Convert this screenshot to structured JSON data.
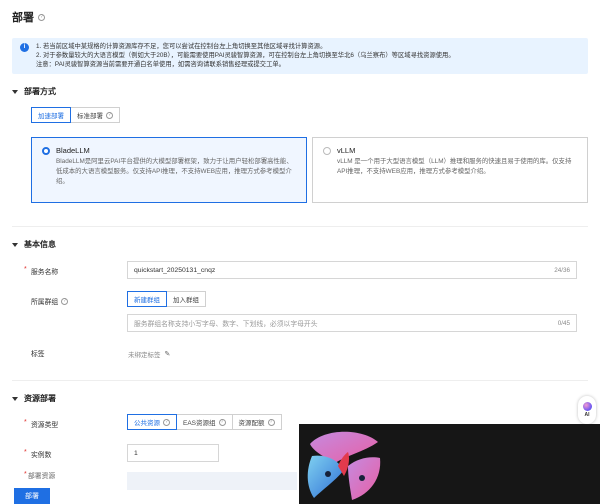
{
  "page": {
    "title": "部署"
  },
  "notice": {
    "line1": "1. 若当前区域中某规格的计算资源库存不足，您可以尝试在控制台左上角切换至其他区域寻找计算资源。",
    "line2": "2. 对于参数量较大的大语言模型（例如大于20B），可能需要使用PAI灵骏智算资源，可在控制台左上角切换至华北6（乌兰察布）等区域寻找资源使用。",
    "line3": "注意：PAI灵骏智算资源当前需要开通白名单使用，如需咨询请联系销售经理或提交工单。"
  },
  "deploy_method": {
    "section_title": "部署方式",
    "tabs": [
      "加速部署",
      "标准部署"
    ],
    "cards": [
      {
        "name": "BladeLLM",
        "desc": "BladeLLM是阿里云PAI平台提供的大模型部署框架，致力于让用户轻松部署高性能、低成本的大语言模型服务。仅支持API推理，不支持WEB应用，推理方式参考模型介绍。"
      },
      {
        "name": "vLLM",
        "desc": "vLLM 是一个用于大型语言模型（LLM）推理和服务的快速且易于使用的库。仅支持API推理，不支持WEB应用，推理方式参考模型介绍。"
      }
    ]
  },
  "basic_info": {
    "section_title": "基本信息",
    "service_name_label": "服务名称",
    "service_name_value": "quickstart_20250131_cnqz",
    "service_name_count": "24/36",
    "group_label": "所属群组",
    "group_tabs": [
      "新建群组",
      "加入群组"
    ],
    "group_placeholder": "服务群组名称支持小写字母、数字、下划线，必须以字母开头",
    "group_count": "0/45",
    "tag_label": "标签",
    "tag_value": "未绑定标签"
  },
  "resource": {
    "section_title": "资源部署",
    "type_label": "资源类型",
    "type_tabs": [
      "公共资源",
      "EAS资源组",
      "资源配额"
    ],
    "instance_label": "实例数",
    "instance_value": "1",
    "partial_label": "部署资源"
  },
  "footer": {
    "deploy_button": "部署"
  },
  "ai_float": {
    "label": "AI"
  },
  "colors": {
    "primary": "#1f6fe3",
    "notice_bg": "#e8f3ff",
    "required": "#e0302d"
  }
}
